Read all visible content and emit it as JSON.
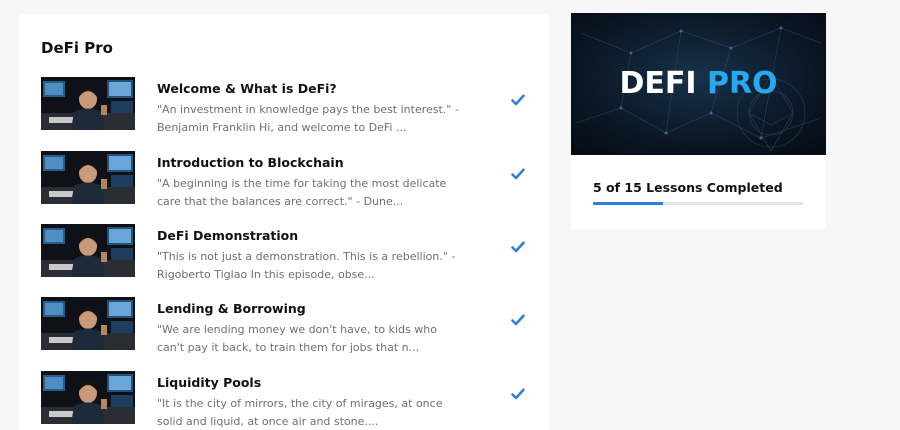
{
  "course": {
    "title": "DeFi Pro",
    "lessons": [
      {
        "title": "Welcome & What is DeFi?",
        "description": "\"An investment in knowledge pays the best interest.\" - Benjamin Franklin Hi, and welcome to DeFi ...",
        "completed": true,
        "thumbnail_icon": "video-thumbnail"
      },
      {
        "title": "Introduction to Blockchain",
        "description": "\"A beginning is the time for taking the most delicate care that the balances are correct.\" - Dune...",
        "completed": true,
        "thumbnail_icon": "video-thumbnail"
      },
      {
        "title": "DeFi Demonstration",
        "description": "\"This is not just a demonstration. This is a rebellion.\" - Rigoberto Tiglao In this episode, obse...",
        "completed": true,
        "thumbnail_icon": "video-thumbnail"
      },
      {
        "title": "Lending & Borrowing",
        "description": "\"We are lending money we don't have, to kids who can't pay it back, to train them for jobs that n...",
        "completed": true,
        "thumbnail_icon": "video-thumbnail"
      },
      {
        "title": "Liquidity Pools",
        "description": "\"It is the city of mirrors, the city of mirages, at once solid and liquid, at once air and stone....",
        "completed": true,
        "thumbnail_icon": "video-thumbnail"
      }
    ]
  },
  "promo": {
    "banner_word_1": "DEFI",
    "banner_word_2": "PRO",
    "progress_label": "5 of 15 Lessons Completed",
    "progress_fraction": 0.333
  },
  "colors": {
    "accent_blue": "#2f7fd8",
    "logo_blue": "#29a8f0",
    "text_muted": "#6f6f6f",
    "page_bg": "#f7f7f7"
  }
}
